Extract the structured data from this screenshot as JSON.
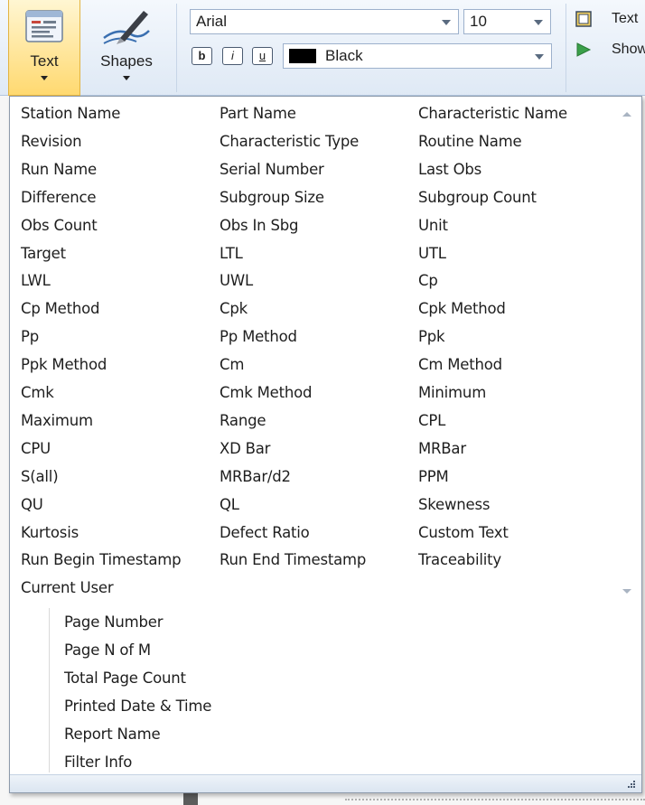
{
  "ribbon": {
    "text_button_label": "Text",
    "shapes_button_label": "Shapes",
    "font_name": "Arial",
    "font_size": "10",
    "bold_label": "b",
    "italic_label": "i",
    "underline_label": "u",
    "color_name": "Black",
    "side_text_label": "Text",
    "side_show_label": "Show"
  },
  "field_columns": [
    [
      "Station Name",
      "Revision",
      "Run Name",
      "Difference",
      "Obs Count",
      "Target",
      "LWL",
      "Cp Method",
      "Pp",
      "Ppk Method",
      "Cmk",
      "Maximum",
      "CPU",
      "S(all)",
      "QU",
      "Kurtosis",
      "Run Begin Timestamp",
      "Current User"
    ],
    [
      "Part Name",
      "Characteristic Type",
      "Serial Number",
      "Subgroup Size",
      "Obs In Sbg",
      "LTL",
      "UWL",
      "Cpk",
      "Pp Method",
      "Cm",
      "Cmk Method",
      "Range",
      "XD Bar",
      "MRBar/d2",
      "QL",
      "Defect Ratio",
      "Run End Timestamp"
    ],
    [
      "Characteristic Name",
      "Routine Name",
      "Last Obs",
      "Subgroup Count",
      "Unit",
      "UTL",
      "Cp",
      "Cpk Method",
      "Ppk",
      "Cm Method",
      "Minimum",
      "CPL",
      "MRBar",
      "PPM",
      "Skewness",
      "Custom Text",
      "Traceability"
    ]
  ],
  "page_items": [
    "Page Number",
    "Page N of M",
    "Total Page Count",
    "Printed Date & Time",
    "Report Name",
    "Filter Info"
  ],
  "colors": {
    "ribbon_bg": "#dfe9f5",
    "selected_button": "#ffd970",
    "popup_border": "#8d9aab",
    "text": "#1e1e1e"
  },
  "icons": [
    "text-box-icon",
    "pen-icon",
    "text-frame-icon",
    "show-arrow-icon",
    "scroll-up-icon",
    "scroll-down-icon",
    "resize-grip-icon"
  ]
}
